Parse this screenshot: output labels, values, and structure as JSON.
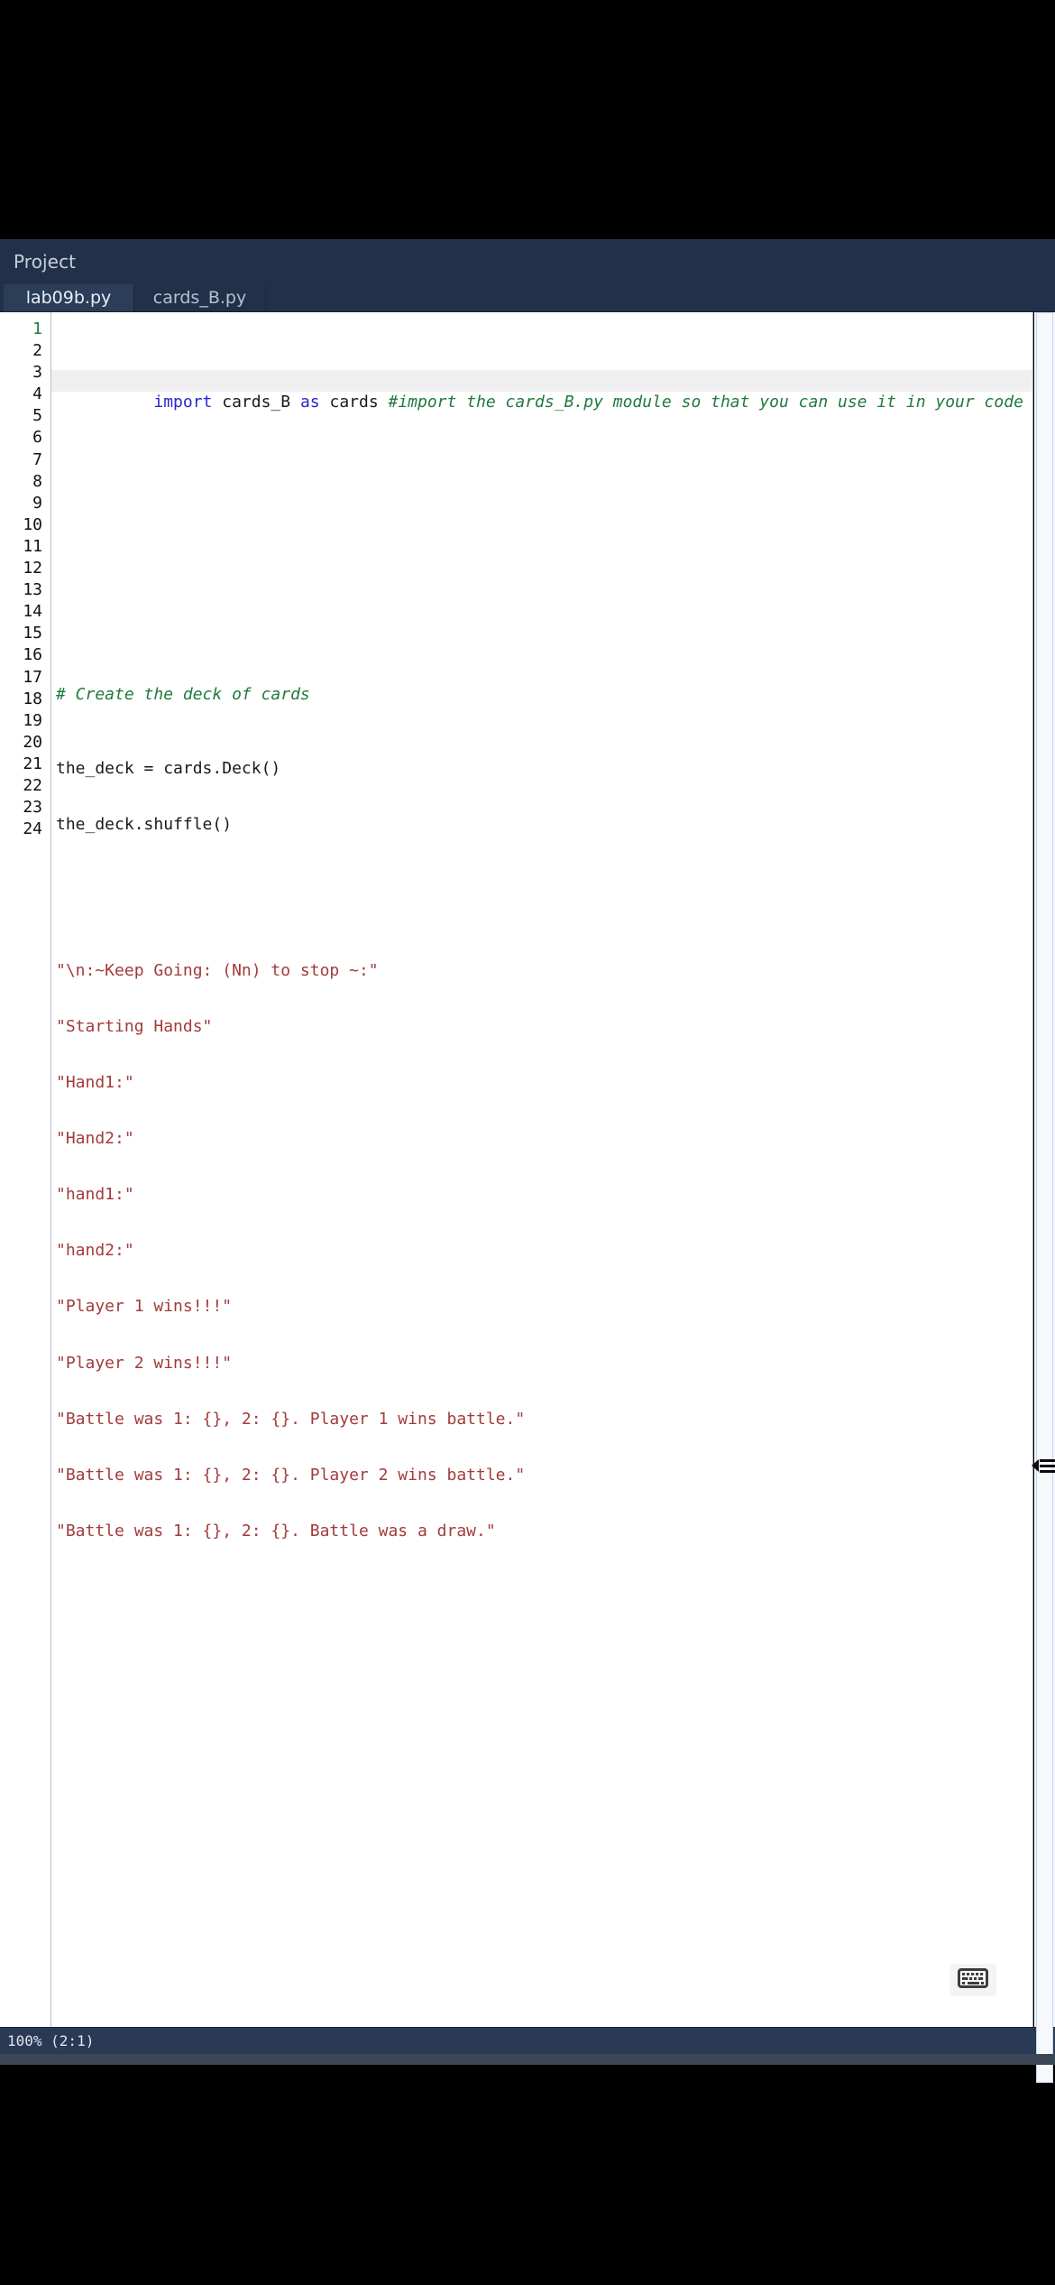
{
  "window": {
    "project_label": "Project",
    "background_color": "#22314a"
  },
  "tabs": [
    {
      "label": "lab09b.py",
      "active": true
    },
    {
      "label": "cards_B.py",
      "active": false
    }
  ],
  "editor": {
    "current_line": 1,
    "total_lines": 24,
    "line_numbers": [
      "1",
      "2",
      "3",
      "4",
      "5",
      "6",
      "7",
      "8",
      "9",
      "10",
      "11",
      "12",
      "13",
      "14",
      "15",
      "16",
      "17",
      "18",
      "19",
      "20",
      "21",
      "22",
      "23",
      "24"
    ],
    "lines": [
      {
        "n": 1,
        "text": "import cards_B as cards #import the cards_B.py module so that you can use it in your code"
      },
      {
        "n": 2,
        "text": ""
      },
      {
        "n": 3,
        "text": ""
      },
      {
        "n": 4,
        "text": ""
      },
      {
        "n": 5,
        "text": ""
      },
      {
        "n": 6,
        "text": "# Create the deck of cards"
      },
      {
        "n": 7,
        "text": "the_deck = cards.Deck()"
      },
      {
        "n": 8,
        "text": "the_deck.shuffle()"
      },
      {
        "n": 9,
        "text": ""
      },
      {
        "n": 10,
        "text": "\"\\n:~Keep Going: (Nn) to stop ~:\""
      },
      {
        "n": 11,
        "text": "\"Starting Hands\""
      },
      {
        "n": 12,
        "text": "\"Hand1:\""
      },
      {
        "n": 13,
        "text": "\"Hand2:\""
      },
      {
        "n": 14,
        "text": "\"hand1:\""
      },
      {
        "n": 15,
        "text": "\"hand2:\""
      },
      {
        "n": 16,
        "text": "\"Player 1 wins!!!\""
      },
      {
        "n": 17,
        "text": "\"Player 2 wins!!!\""
      },
      {
        "n": 18,
        "text": "\"Battle was 1: {}, 2: {}. Player 1 wins battle.\""
      },
      {
        "n": 19,
        "text": "\"Battle was 1: {}, 2: {}. Player 2 wins battle.\""
      },
      {
        "n": 20,
        "text": "\"Battle was 1: {}, 2: {}. Battle was a draw.\""
      },
      {
        "n": 21,
        "text": ""
      },
      {
        "n": 22,
        "text": ""
      },
      {
        "n": 23,
        "text": ""
      },
      {
        "n": 24,
        "text": ""
      }
    ],
    "line1_tokens": [
      {
        "t": "import",
        "c": "kw"
      },
      {
        "t": " cards_B ",
        "c": "plain"
      },
      {
        "t": "as",
        "c": "kw"
      },
      {
        "t": " cards ",
        "c": "plain"
      },
      {
        "t": "#import the cards_B.py module so that you can use it in your code",
        "c": "comment"
      }
    ],
    "colors": {
      "keyword": "#2727d0",
      "comment": "#1f7a3d",
      "string": "#a33b3b",
      "plain": "#1a1a1a",
      "current_line_bg": "#f0f0f0",
      "gutter_current": "#1f7a3d"
    }
  },
  "status_bar": {
    "text": "100%  (2:1)"
  },
  "controls": {
    "keyboard_icon": "keyboard-icon",
    "drawer_tab_icon": "hamburger-icon"
  }
}
